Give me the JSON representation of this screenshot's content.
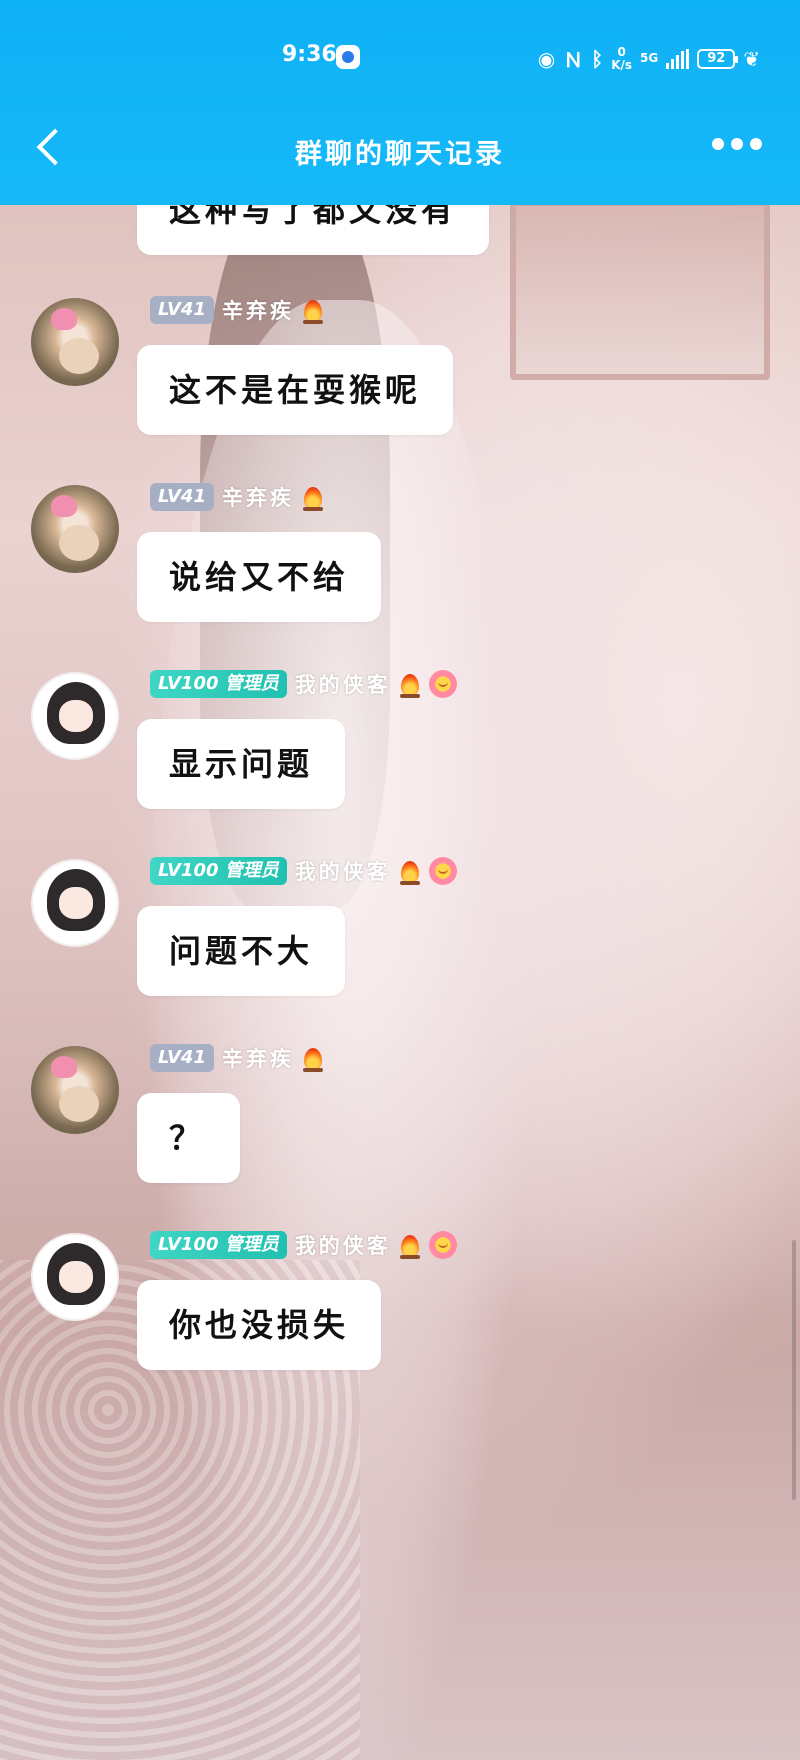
{
  "status_bar": {
    "time": "9:36",
    "speed_value": "0",
    "speed_unit": "K/s",
    "network": "5G",
    "battery": "92",
    "icons": [
      "eye-icon",
      "nfc-icon",
      "bluetooth-icon",
      "signal-icon",
      "battery-icon",
      "leaf-icon"
    ]
  },
  "header": {
    "title": "群聊的聊天记录",
    "back_icon": "back-arrow-icon",
    "more_icon": "more-dots-icon",
    "bar_color": "#14b5f7"
  },
  "partial_message": {
    "text": "这种写了都又没有"
  },
  "messages": [
    {
      "sender": "辛弃疾",
      "level": "LV41",
      "role": "",
      "text": "这不是在耍猴呢",
      "badges": [
        "fire-icon"
      ],
      "avatar": "cat-avatar"
    },
    {
      "sender": "辛弃疾",
      "level": "LV41",
      "role": "",
      "text": "说给又不给",
      "badges": [
        "fire-icon"
      ],
      "avatar": "cat-avatar"
    },
    {
      "sender": "我的侠客",
      "level": "LV100",
      "role": "管理员",
      "text": "显示问题",
      "badges": [
        "fire-icon",
        "flower-emoji-icon"
      ],
      "avatar": "girl-avatar"
    },
    {
      "sender": "我的侠客",
      "level": "LV100",
      "role": "管理员",
      "text": "问题不大",
      "badges": [
        "fire-icon",
        "flower-emoji-icon"
      ],
      "avatar": "girl-avatar"
    },
    {
      "sender": "辛弃疾",
      "level": "LV41",
      "role": "",
      "text": "？",
      "badges": [
        "fire-icon"
      ],
      "avatar": "cat-avatar"
    },
    {
      "sender": "我的侠客",
      "level": "LV100",
      "role": "管理员",
      "text": "你也没损失",
      "badges": [
        "fire-icon",
        "flower-emoji-icon"
      ],
      "avatar": "girl-avatar"
    }
  ]
}
